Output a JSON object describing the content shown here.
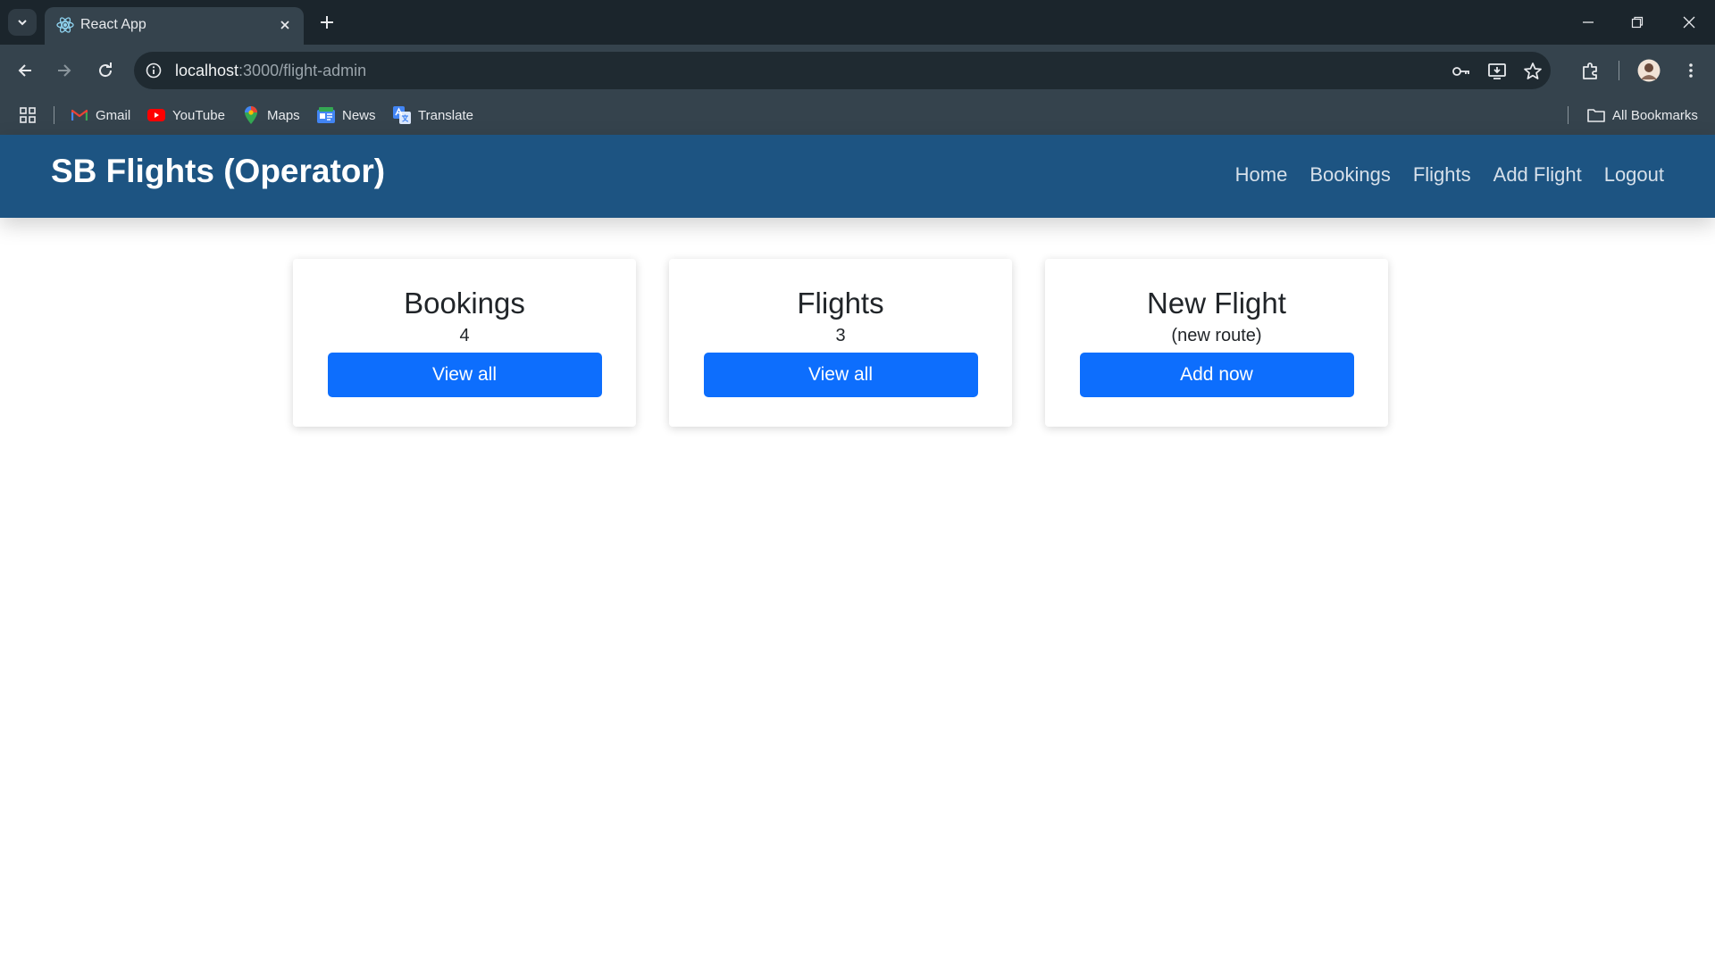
{
  "browser": {
    "tab": {
      "title": "React App",
      "favicon": "react-icon"
    },
    "url": {
      "host": "localhost",
      "path": ":3000/flight-admin"
    },
    "bookmarks": [
      {
        "label": "Gmail",
        "icon": "gmail-icon"
      },
      {
        "label": "YouTube",
        "icon": "youtube-icon"
      },
      {
        "label": "Maps",
        "icon": "maps-icon"
      },
      {
        "label": "News",
        "icon": "news-icon"
      },
      {
        "label": "Translate",
        "icon": "translate-icon"
      }
    ],
    "all_bookmarks_label": "All Bookmarks"
  },
  "header": {
    "brand": "SB Flights (Operator)",
    "nav": [
      "Home",
      "Bookings",
      "Flights",
      "Add Flight",
      "Logout"
    ]
  },
  "cards": [
    {
      "title": "Bookings",
      "value": "4",
      "button": "View all"
    },
    {
      "title": "Flights",
      "value": "3",
      "button": "View all"
    },
    {
      "title": "New Flight",
      "value": "(new route)",
      "button": "Add now"
    }
  ],
  "colors": {
    "header_bg": "#1d5482",
    "primary_button": "#0d6efd",
    "browser_chrome": "#35434d"
  }
}
